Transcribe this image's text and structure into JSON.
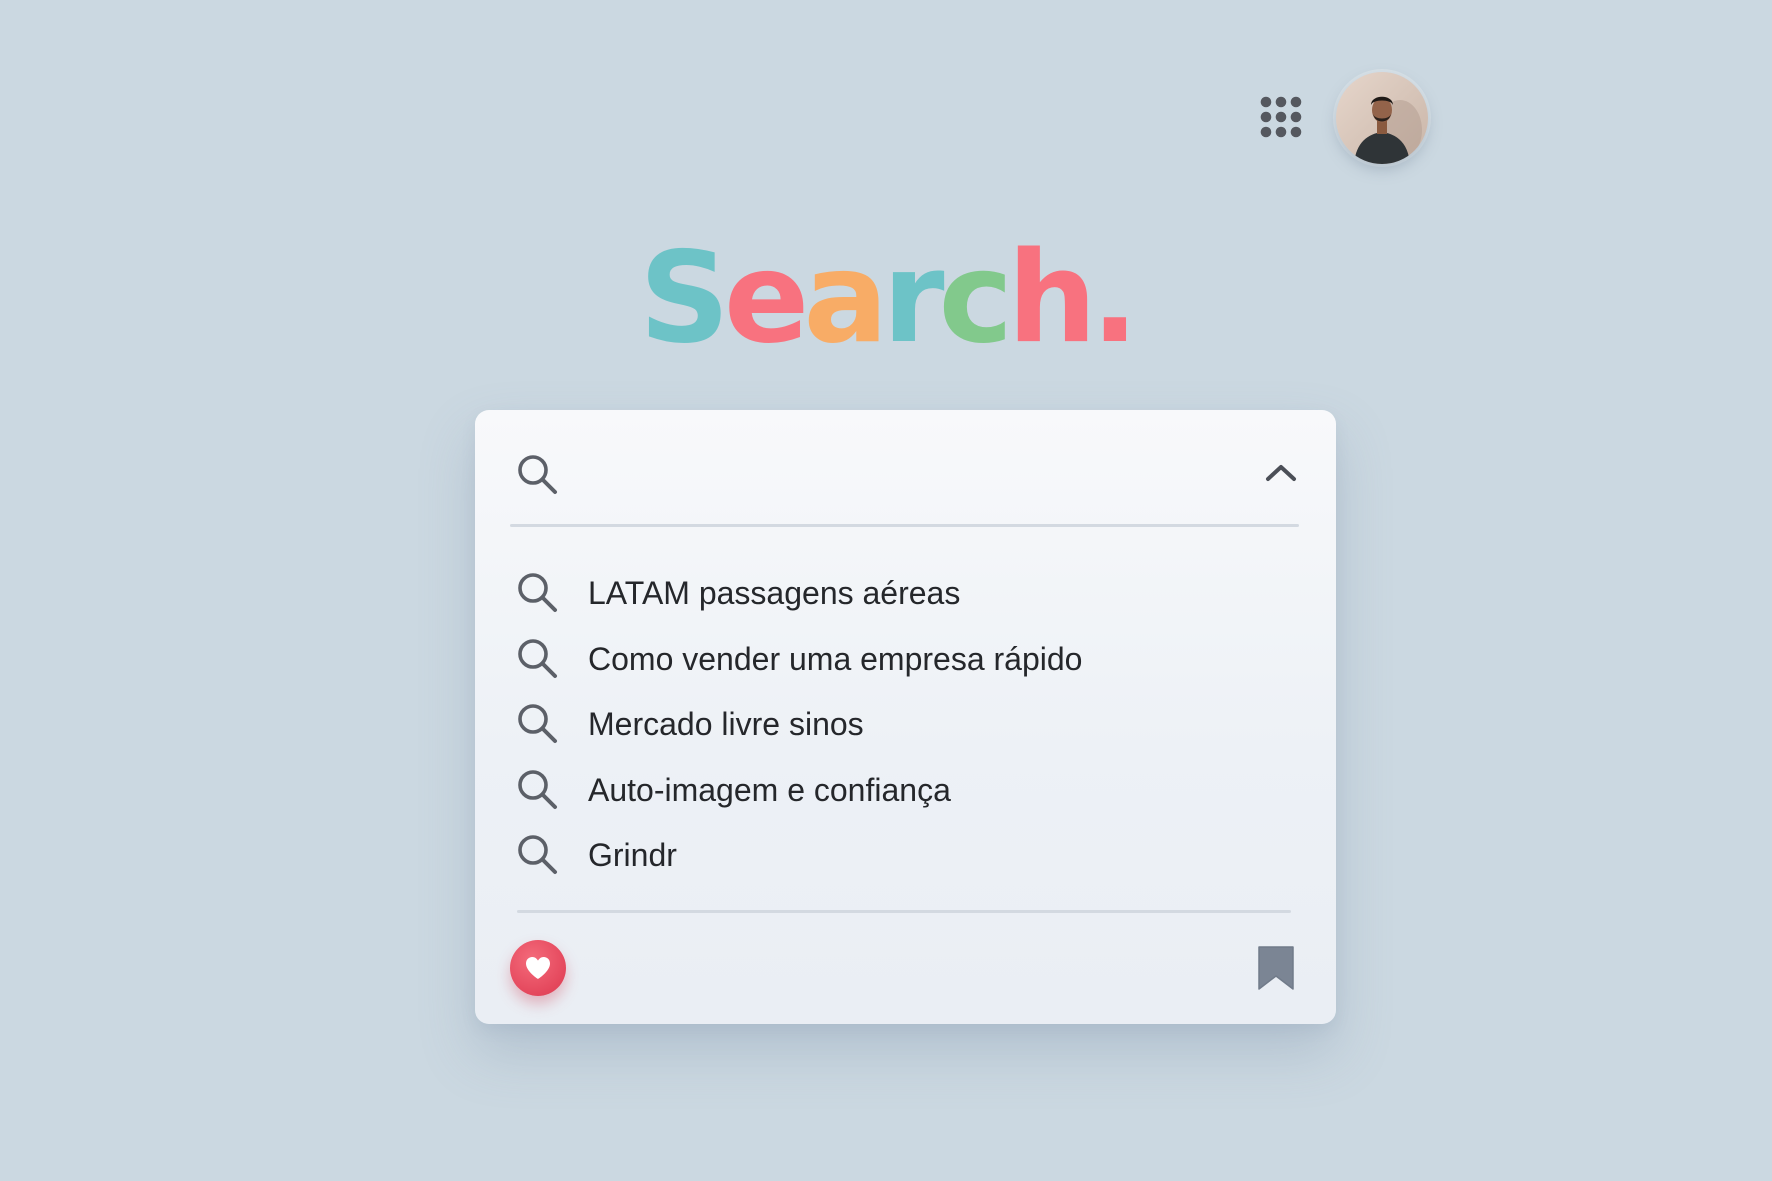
{
  "header": {
    "apps_icon": "grid-dots-icon",
    "avatar_icon": "user-avatar"
  },
  "logo": {
    "letters": [
      {
        "char": "S",
        "color": "#6dc3c7"
      },
      {
        "char": "e",
        "color": "#f8727f"
      },
      {
        "char": "a",
        "color": "#f8ac66"
      },
      {
        "char": "r",
        "color": "#6dc3c7"
      },
      {
        "char": "c",
        "color": "#82c98c"
      },
      {
        "char": "h",
        "color": "#f8727f"
      },
      {
        "char": ".",
        "color": "#f8727f"
      }
    ]
  },
  "search": {
    "value": "",
    "placeholder": "",
    "icon": "search-icon",
    "collapse_icon": "chevron-up-icon"
  },
  "suggestions": [
    {
      "label": "LATAM passagens aéreas",
      "icon": "search-icon"
    },
    {
      "label": "Como vender uma empresa rápido",
      "icon": "search-icon"
    },
    {
      "label": "Mercado livre sinos",
      "icon": "search-icon"
    },
    {
      "label": "Auto-imagem e confiança",
      "icon": "search-icon"
    },
    {
      "label": "Grindr",
      "icon": "search-icon"
    }
  ],
  "footer": {
    "favorite_icon": "heart-icon",
    "bookmark_icon": "bookmark-icon"
  },
  "colors": {
    "background": "#cbd8e1",
    "favorite": "#e4475c",
    "icon_gray": "#5c6068",
    "bookmark": "#7b8594"
  }
}
